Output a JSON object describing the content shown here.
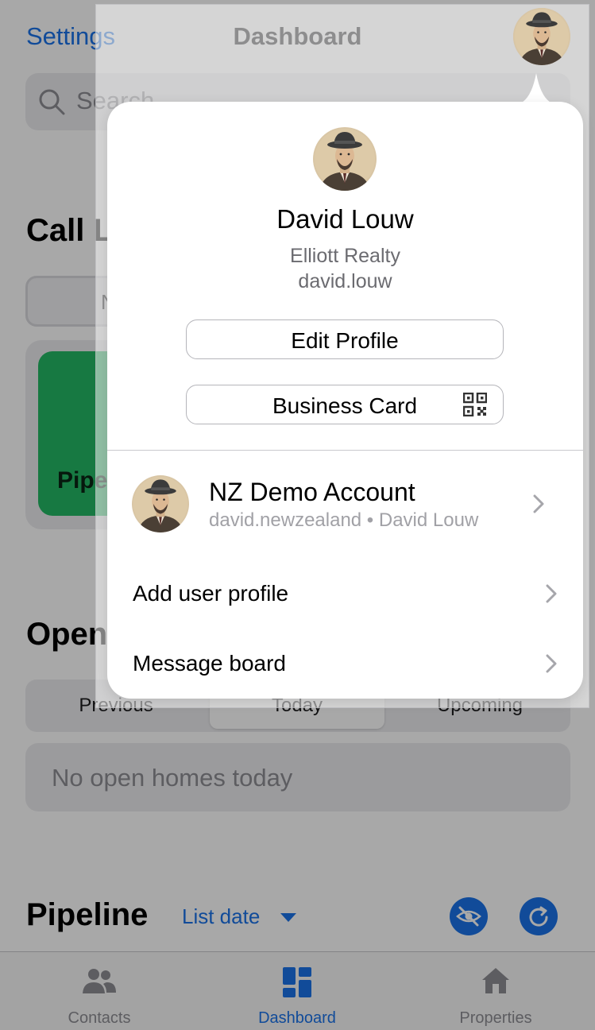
{
  "nav": {
    "back_label": "Settings",
    "title": "Dashboard"
  },
  "search": {
    "placeholder": "Search"
  },
  "call_list": {
    "title": "Call L",
    "segment_label": "N",
    "tile_label": "Pipe",
    "tile_color": "#23b864"
  },
  "open_homes": {
    "title": "Open",
    "segments": [
      "Previous",
      "Today",
      "Upcoming"
    ],
    "selected": "Today",
    "empty_text": "No open homes today"
  },
  "pipeline": {
    "title": "Pipeline",
    "sort_label": "List date"
  },
  "tabbar": {
    "items": [
      {
        "label": "Contacts",
        "icon": "contacts-icon",
        "active": false
      },
      {
        "label": "Dashboard",
        "icon": "dashboard-icon",
        "active": true
      },
      {
        "label": "Properties",
        "icon": "home-icon",
        "active": false
      }
    ]
  },
  "profile_popover": {
    "name": "David Louw",
    "agency": "Elliott Realty",
    "username": "david.louw",
    "edit_profile_label": "Edit Profile",
    "business_card_label": "Business Card",
    "account": {
      "name": "NZ Demo Account",
      "subtitle": "david.newzealand • David Louw"
    },
    "menu": [
      {
        "label": "Add user profile"
      },
      {
        "label": "Message board"
      }
    ]
  },
  "colors": {
    "accent": "#1a73e8",
    "tab_inactive": "#8e8e93",
    "text_secondary": "#6b6b70"
  }
}
